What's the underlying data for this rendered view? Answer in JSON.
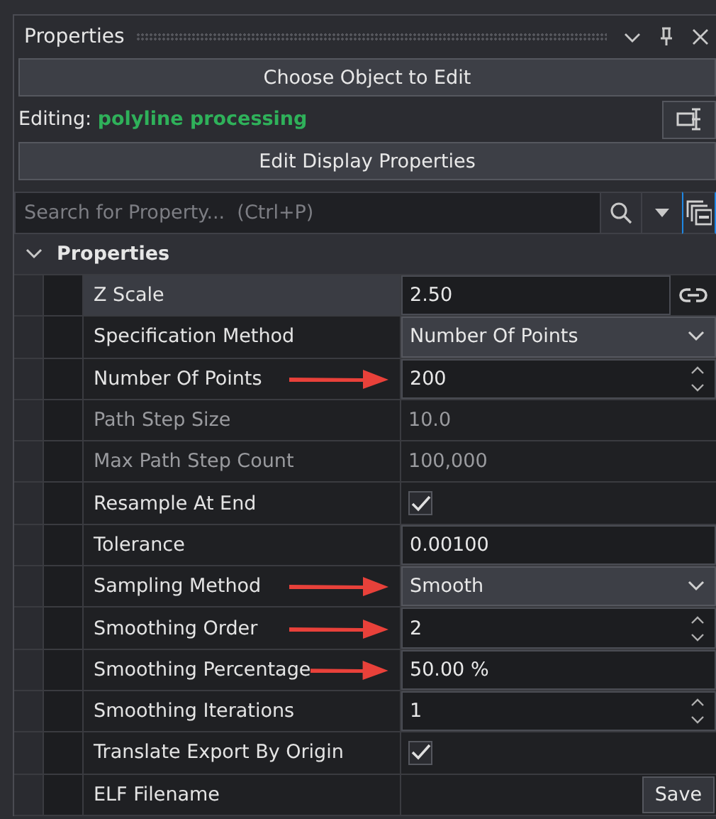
{
  "panel": {
    "title": "Properties",
    "choose_button": "Choose Object to Edit",
    "editing_label": "Editing:",
    "editing_object": "polyline processing",
    "display_button": "Edit Display Properties",
    "search": {
      "placeholder": "Search for Property...  (Ctrl+P)"
    },
    "section": {
      "title": "Properties",
      "expanded": true
    },
    "rows": [
      {
        "label": "Z Scale",
        "kind": "linked",
        "value": "2.50",
        "selected": true,
        "disabled": false,
        "arrow": false
      },
      {
        "label": "Specification Method",
        "kind": "dropdown",
        "value": "Number Of Points",
        "selected": false,
        "disabled": false,
        "arrow": false
      },
      {
        "label": "Number Of Points",
        "kind": "spinner",
        "value": "200",
        "selected": false,
        "disabled": false,
        "arrow": true
      },
      {
        "label": "Path Step Size",
        "kind": "text",
        "value": "10.0",
        "selected": false,
        "disabled": true,
        "arrow": false
      },
      {
        "label": "Max Path Step Count",
        "kind": "text",
        "value": "100,000",
        "selected": false,
        "disabled": true,
        "arrow": false
      },
      {
        "label": "Resample At End",
        "kind": "checkbox",
        "checked": true,
        "selected": false,
        "disabled": false,
        "arrow": false
      },
      {
        "label": "Tolerance",
        "kind": "field",
        "value": "0.00100",
        "selected": false,
        "disabled": false,
        "arrow": false
      },
      {
        "label": "Sampling Method",
        "kind": "dropdown",
        "value": "Smooth",
        "selected": false,
        "disabled": false,
        "arrow": true
      },
      {
        "label": "Smoothing Order",
        "kind": "spinner",
        "value": "2",
        "selected": false,
        "disabled": false,
        "arrow": true
      },
      {
        "label": "Smoothing Percentage",
        "kind": "field",
        "value": "50.00 %",
        "selected": false,
        "disabled": false,
        "arrow": true
      },
      {
        "label": "Smoothing Iterations",
        "kind": "spinner",
        "value": "1",
        "selected": false,
        "disabled": false,
        "arrow": false
      },
      {
        "label": "Translate Export By Origin",
        "kind": "checkbox",
        "checked": true,
        "selected": false,
        "disabled": false,
        "arrow": false
      },
      {
        "label": "ELF Filename",
        "kind": "button",
        "button": "Save",
        "selected": false,
        "disabled": false,
        "arrow": false
      }
    ]
  }
}
